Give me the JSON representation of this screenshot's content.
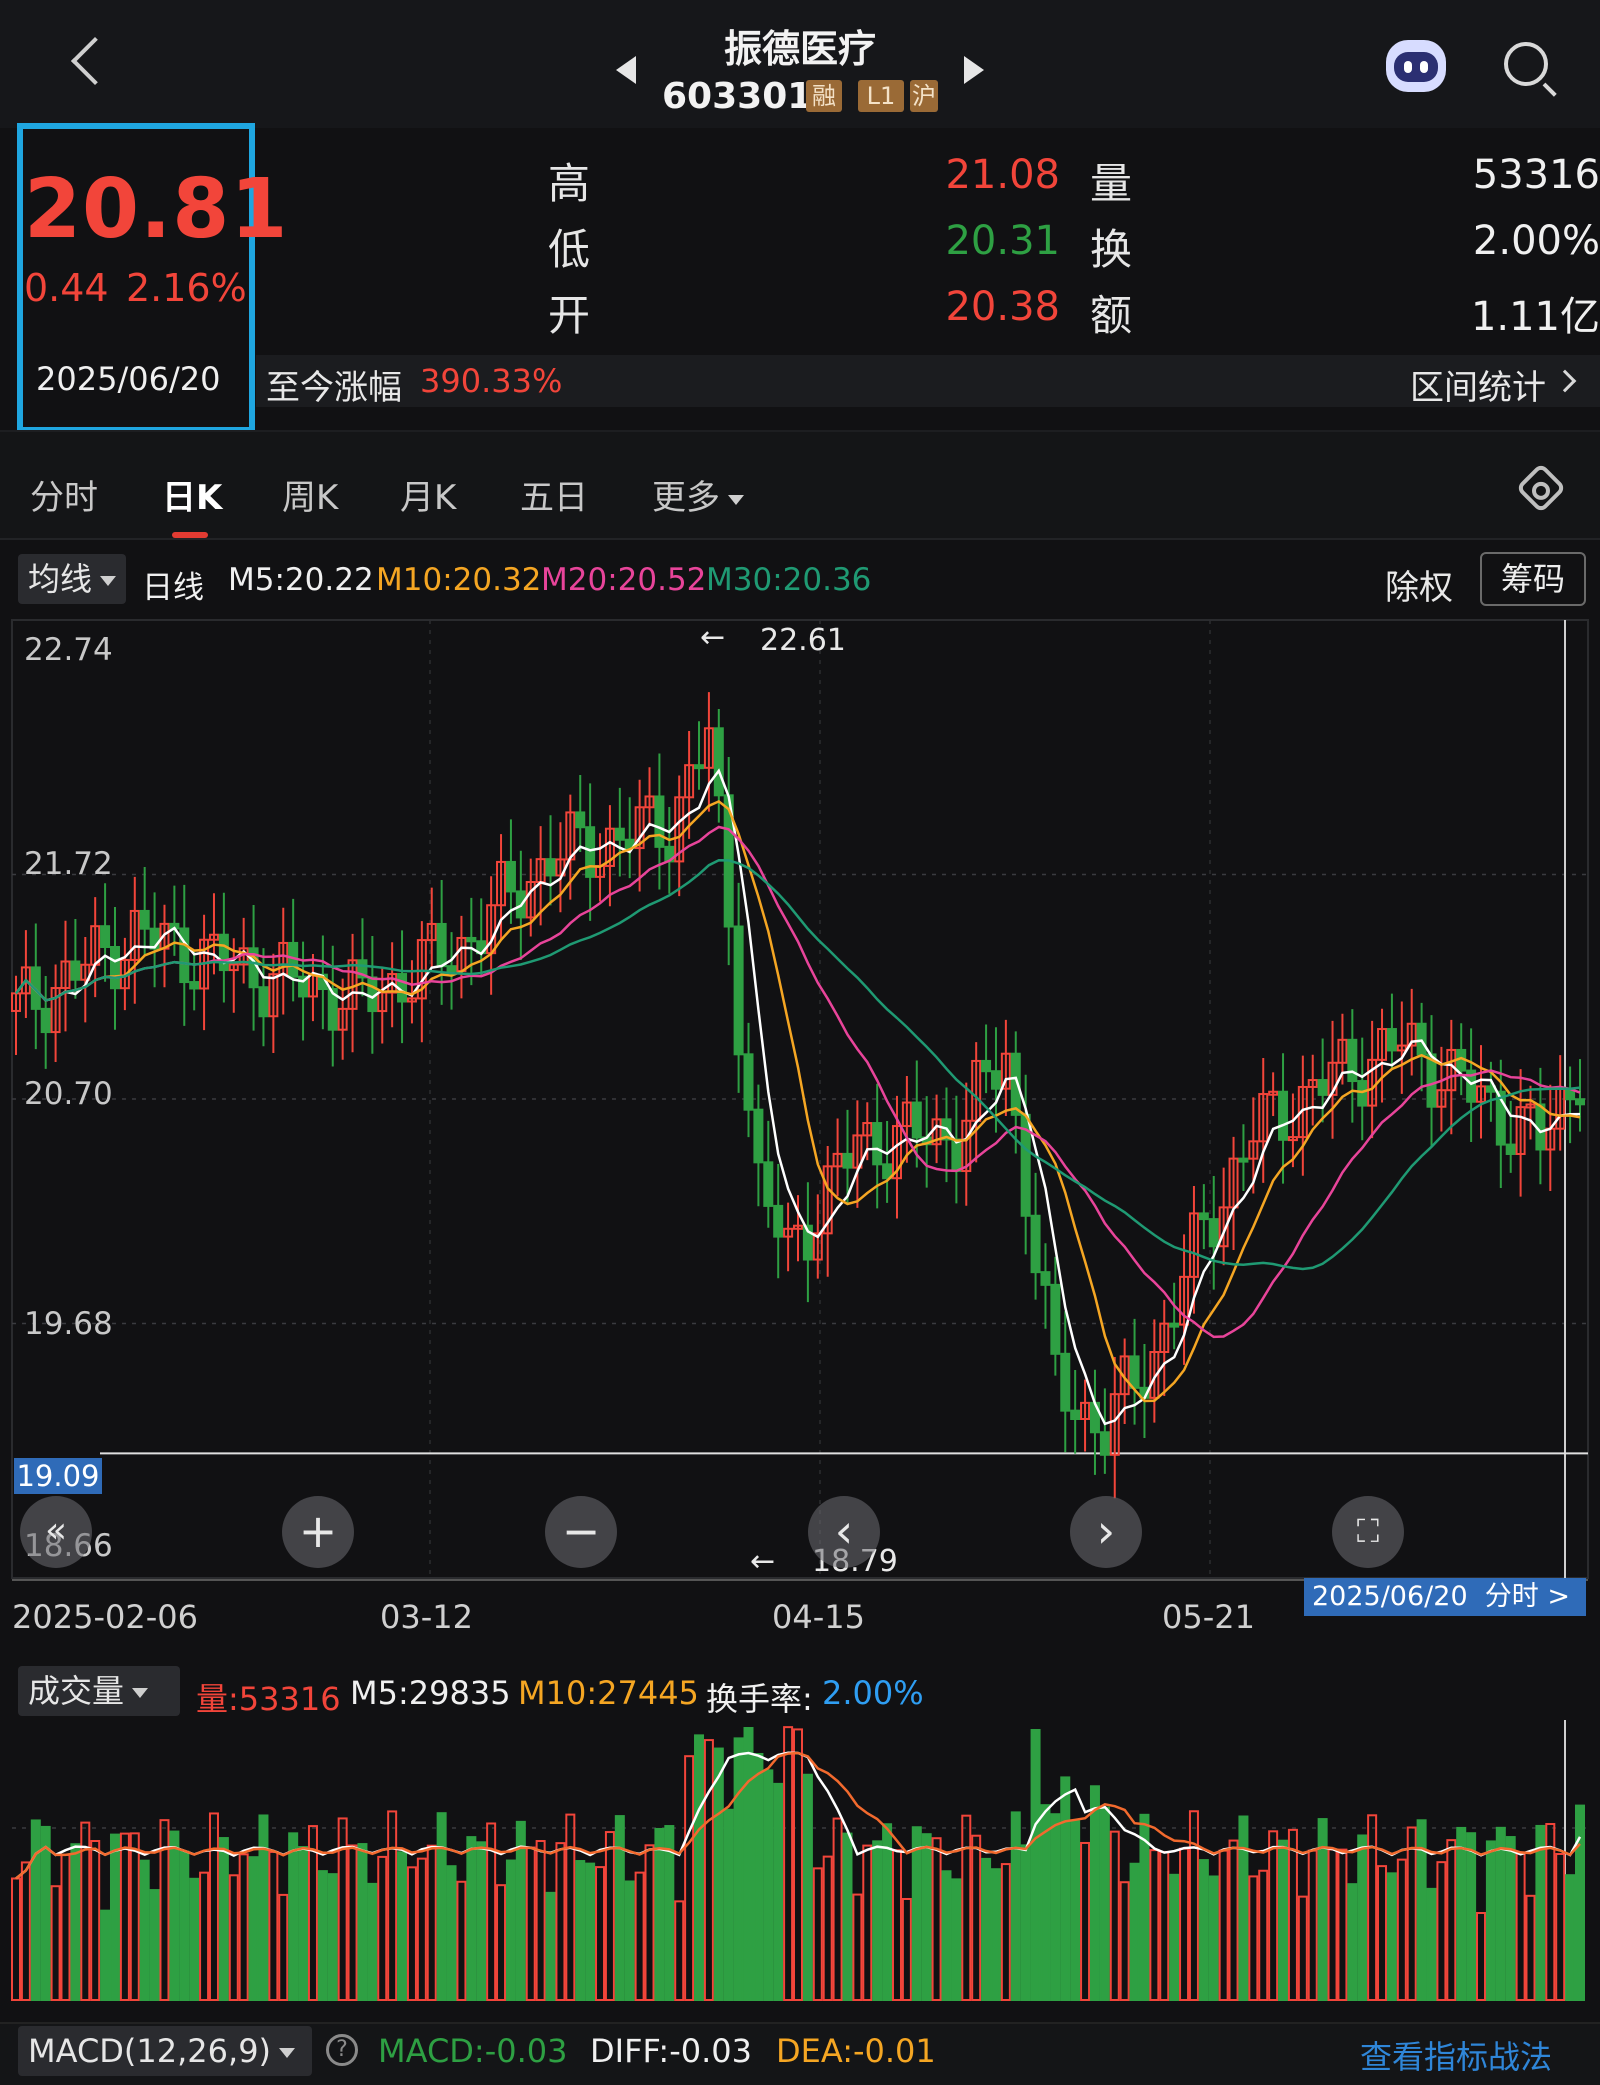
{
  "header": {
    "stock_name": "振德医疗",
    "stock_code": "603301",
    "tags": [
      "融",
      "L1",
      "沪"
    ]
  },
  "quote": {
    "price": "20.81",
    "change": "0.44",
    "change_pct": "2.16%",
    "date": "2025/06/20",
    "rows": [
      {
        "label": "高",
        "value": "21.08",
        "label2": "量",
        "value2": "53316"
      },
      {
        "label": "低",
        "value": "20.31",
        "label2": "换",
        "value2": "2.00%"
      },
      {
        "label": "开",
        "value": "20.38",
        "label2": "额",
        "value2": "1.11亿"
      }
    ],
    "since_label": "至今涨幅",
    "since_value": "390.33%",
    "range_stats": "区间统计"
  },
  "tabs": [
    "分时",
    "日K",
    "周K",
    "月K",
    "五日",
    "更多"
  ],
  "active_tab": "日K",
  "ma_bar": {
    "selector": "均线",
    "period": "日线",
    "m5": "M5:20.22",
    "m10": "M10:20.32",
    "m20": "M20:20.52",
    "m30": "M30:20.36",
    "adjust": "除权",
    "chips": "筹码"
  },
  "chart_data": [
    {
      "type": "candlestick",
      "y_ticks": [
        "22.74",
        "21.72",
        "20.70",
        "19.68",
        "18.66"
      ],
      "ylim": [
        18.66,
        22.74
      ],
      "x_ticks": [
        "2025-02-06",
        "03-12",
        "04-15",
        "05-21"
      ],
      "crosshair_value": "19.09",
      "high_label": "22.61",
      "low_label": "18.79",
      "date_badge": "2025/06/20",
      "date_badge_action": "分时",
      "colors": {
        "up": "#f2453a",
        "down": "#2ea043",
        "m5": "#ffffff",
        "m10": "#f5a623",
        "m20": "#e8449a",
        "m30": "#1f9a73"
      }
    },
    {
      "type": "bar",
      "title": "成交量",
      "volume": "量:53316",
      "m5": "M5:29835",
      "m10": "M10:27445",
      "turnover_label": "换手率:",
      "turnover": "2.00%"
    }
  ],
  "macd_bar": {
    "selector": "MACD(12,26,9)",
    "macd": "MACD:-0.03",
    "diff": "DIFF:-0.03",
    "dea": "DEA:-0.01",
    "link": "查看指标战法"
  }
}
